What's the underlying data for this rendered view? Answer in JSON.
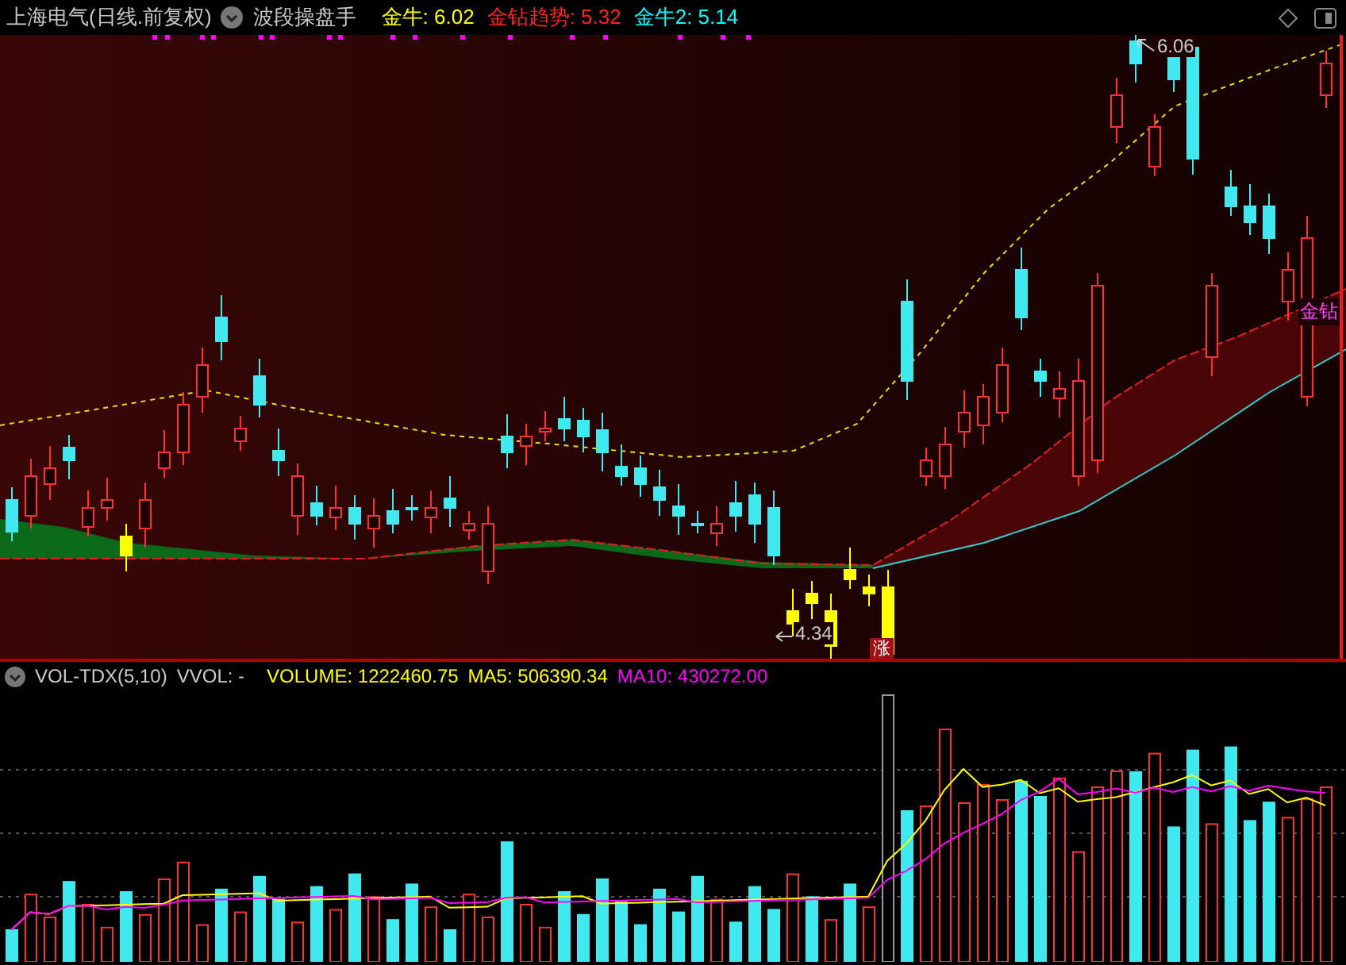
{
  "header": {
    "title": "上海电气(日线.前复权)",
    "indicator_name": "波段操盘手",
    "legend": [
      {
        "label": "金牛: 6.02",
        "color": "#ffff00"
      },
      {
        "label": "金钻趋势: 5.32",
        "color": "#ff2020"
      },
      {
        "label": "金牛2: 5.14",
        "color": "#00ffff"
      }
    ]
  },
  "price_chart": {
    "high_label": "6.06",
    "low_label": "4.34",
    "line_label": "金钻",
    "signal_badge": "涨"
  },
  "volume_header": {
    "title": "VOL-TDX(5,10)",
    "sub": "VVOL: -",
    "legend": [
      {
        "label": "VOLUME: 1222460.75",
        "color": "#ffff00"
      },
      {
        "label": "MA5: 506390.34",
        "color": "#ffff00"
      },
      {
        "label": "MA10: 430272.00",
        "color": "#ff00ff"
      }
    ]
  }
}
